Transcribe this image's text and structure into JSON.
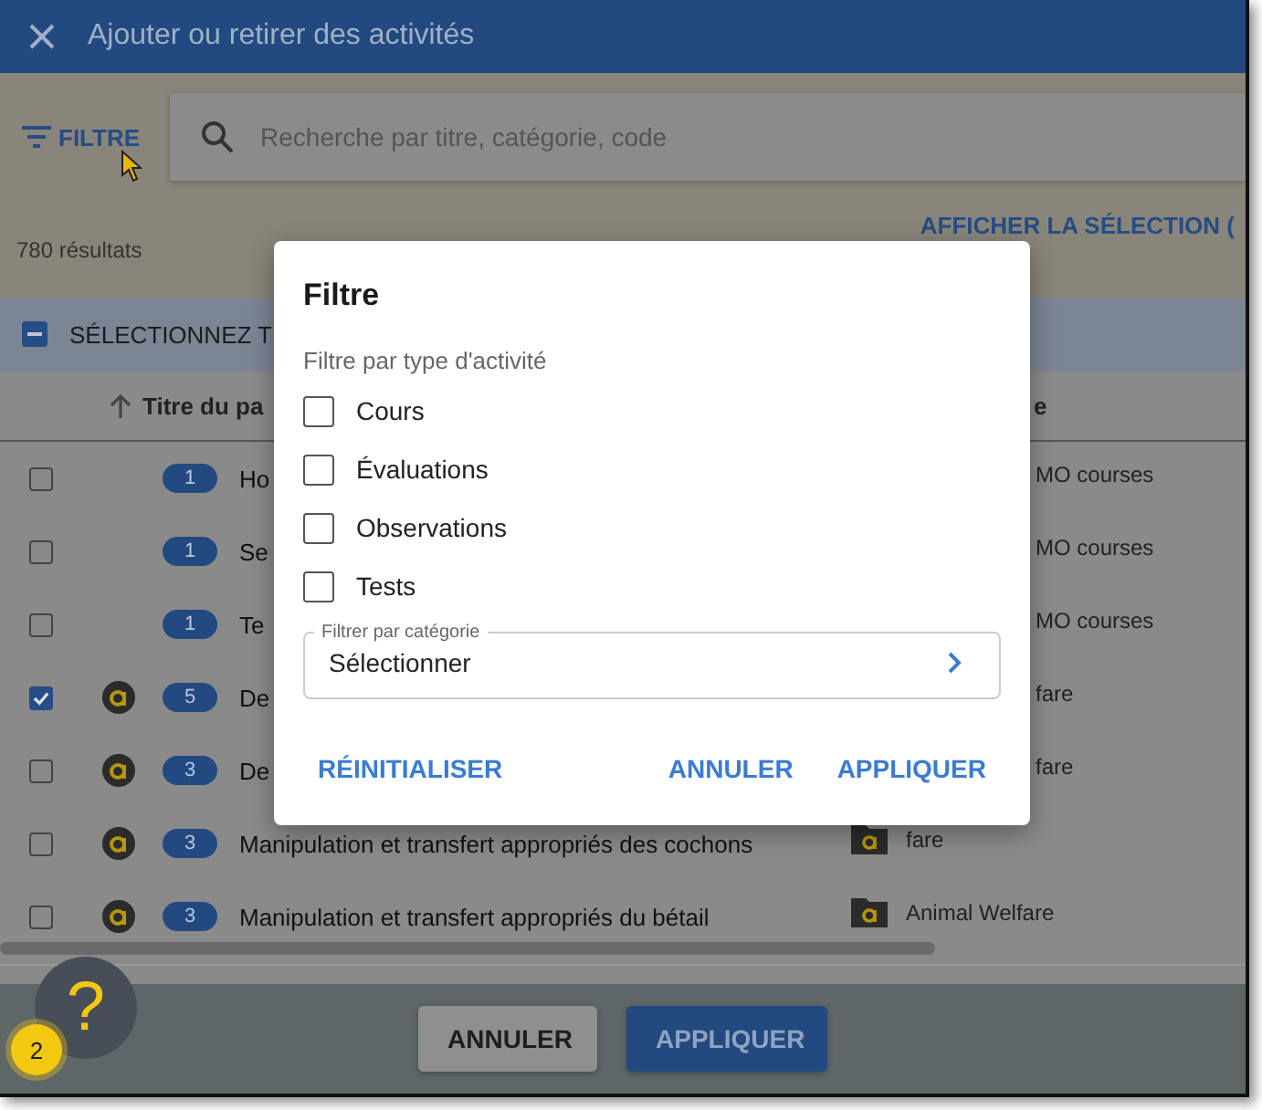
{
  "window": {
    "title": "Ajouter ou retirer des activités"
  },
  "toolbar": {
    "filter_label": "FILTRE",
    "search": {
      "placeholder": "Recherche par titre, catégorie, code"
    }
  },
  "results": {
    "count": "780 résultats",
    "show_selection": "AFFICHER LA SÉLECTION ("
  },
  "select_all": {
    "label": "SÉLECTIONNEZ T",
    "indeterminate": true
  },
  "table": {
    "columns": [
      {
        "label": "Titre du pa",
        "sorted": true
      },
      {
        "label": "e",
        "sorted": false
      }
    ],
    "rows": [
      {
        "checked": false,
        "logo": false,
        "count": "1",
        "title": "Ho",
        "category_icon": false,
        "category": "MO courses"
      },
      {
        "checked": false,
        "logo": false,
        "count": "1",
        "title": "Se",
        "category_icon": false,
        "category": "MO courses"
      },
      {
        "checked": false,
        "logo": false,
        "count": "1",
        "title": "Te",
        "category_icon": false,
        "category": "MO courses"
      },
      {
        "checked": true,
        "logo": true,
        "count": "5",
        "title": "De",
        "category_icon": false,
        "category": "fare"
      },
      {
        "checked": false,
        "logo": true,
        "count": "3",
        "title": "De",
        "category_icon": false,
        "category": "fare"
      },
      {
        "checked": false,
        "logo": true,
        "count": "3",
        "title": "Manipulation et transfert appropriés des cochons",
        "category_icon": true,
        "category": "fare"
      },
      {
        "checked": false,
        "logo": true,
        "count": "3",
        "title": "Manipulation et transfert appropriés du bétail",
        "category_icon": true,
        "category": "Animal Welfare"
      }
    ]
  },
  "footer": {
    "buttons": [
      {
        "label": "ANNULER",
        "kind": "secondary"
      },
      {
        "label": "APPLIQUER",
        "kind": "primary"
      }
    ]
  },
  "help": {
    "symbol": "?",
    "badge": "2"
  },
  "dialog": {
    "title": "Filtre",
    "section_label": "Filtre par type d'activité",
    "options": [
      {
        "label": "Cours",
        "checked": false
      },
      {
        "label": "Évaluations",
        "checked": false
      },
      {
        "label": "Observations",
        "checked": false
      },
      {
        "label": "Tests",
        "checked": false
      }
    ],
    "category_field": {
      "label": "Filtrer par catégorie",
      "value": "Sélectionner"
    },
    "actions": [
      {
        "label": "RÉINITIALISER",
        "kind": "left"
      },
      {
        "label": "ANNULER",
        "kind": "right"
      },
      {
        "label": "APPLIQUER",
        "kind": "right"
      }
    ]
  }
}
